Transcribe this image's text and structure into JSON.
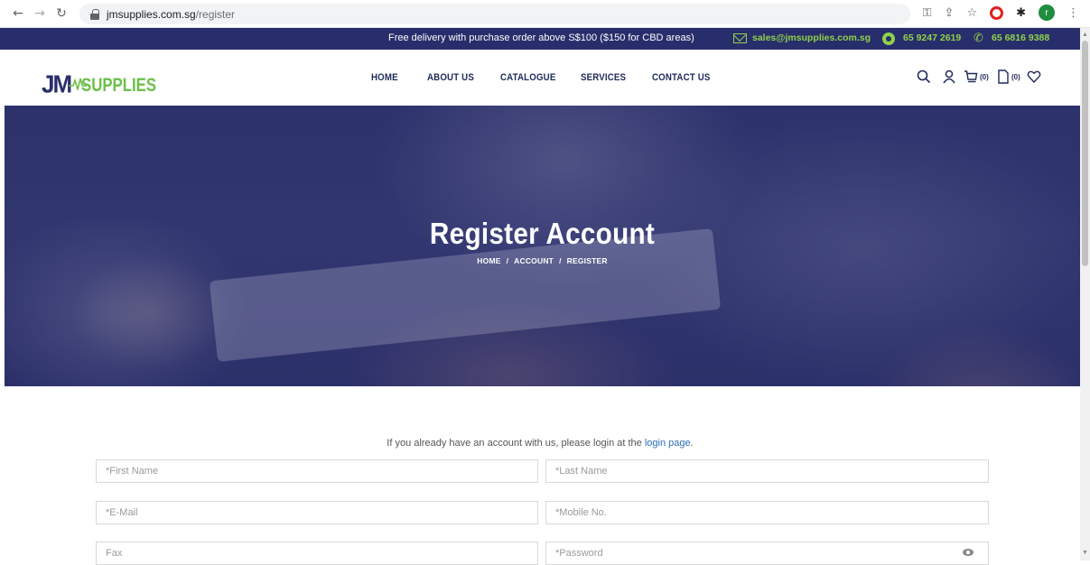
{
  "browser": {
    "url_host": "jmsupplies.com.sg",
    "url_path": "/register",
    "back_icon": "arrow-left-icon",
    "forward_icon": "arrow-right-icon",
    "reload_icon": "reload-icon",
    "avatar_letter": "r"
  },
  "topbar": {
    "promo": "Free delivery with purchase order above S$100 ($150 for CBD areas)",
    "email": "sales@jmsupplies.com.sg",
    "whatsapp": "65 9247 2619",
    "phone": "65 6816 9388"
  },
  "logo": {
    "jm": "JM",
    "supplies": "SUPPLIES"
  },
  "nav": {
    "items": [
      {
        "label": "HOME"
      },
      {
        "label": "ABOUT US"
      },
      {
        "label": "CATALOGUE"
      },
      {
        "label": "SERVICES"
      },
      {
        "label": "CONTACT US"
      }
    ]
  },
  "header_icons": {
    "cart_count": "(0)",
    "quote_count": "(0)"
  },
  "hero": {
    "title": "Register Account",
    "breadcrumb": [
      "HOME",
      "/",
      "ACCOUNT",
      "/",
      "REGISTER"
    ]
  },
  "form": {
    "notice_text": "If you already have an account with us, please login at the ",
    "notice_link": "login page",
    "notice_end": ".",
    "first_name": "*First Name",
    "last_name": "*Last Name",
    "email": "*E-Mail",
    "mobile": "*Mobile No.",
    "fax": "Fax",
    "password": "*Password"
  },
  "colors": {
    "brand_navy": "#282d6b",
    "brand_green": "#6cc04a",
    "link_blue": "#2c6fb7"
  }
}
